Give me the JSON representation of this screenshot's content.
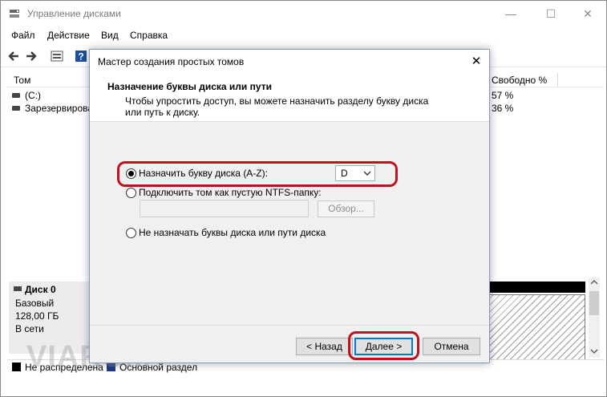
{
  "app": {
    "title": "Управление дисками",
    "icon": "disk-management-icon"
  },
  "window_controls": {
    "minimize": "—",
    "maximize": "☐",
    "close": "✕"
  },
  "menu": [
    "Файл",
    "Действие",
    "Вид",
    "Справка"
  ],
  "toolbar": {
    "icons": [
      "back-arrow-icon",
      "forward-arrow-icon",
      "disk-list-icon",
      "help-icon"
    ],
    "help_glyph": "?"
  },
  "volumes": {
    "columns": {
      "name": "Том",
      "free_percent": "Свободно %"
    },
    "rows": [
      {
        "name": "(C:)",
        "free": "57 %"
      },
      {
        "name": "Зарезервирова",
        "free": "36 %"
      }
    ]
  },
  "disk": {
    "name": "Диск 0",
    "type": "Базовый",
    "size": "128,00 ГБ",
    "status": "В сети"
  },
  "legend": {
    "unallocated": "Не распределена",
    "primary": "Основной раздел"
  },
  "watermark": "VIARUM",
  "dialog": {
    "title": "Мастер создания простых томов",
    "close": "✕",
    "heading": "Назначение буквы диска или пути",
    "description": "Чтобы упростить доступ, вы можете назначить разделу букву диска или путь к диску.",
    "options": {
      "assign_letter": "Назначить букву диска (A-Z):",
      "mount_folder": "Подключить том как пустую NTFS-папку:",
      "no_letter": "Не назначать буквы диска или пути диска"
    },
    "selected_option": "assign_letter",
    "letter": "D",
    "folder_path": "",
    "browse": "Обзор...",
    "buttons": {
      "back": "< Назад",
      "next": "Далее >",
      "cancel": "Отмена"
    }
  },
  "colors": {
    "highlight": "#c0121e",
    "focus": "#0078d7"
  }
}
